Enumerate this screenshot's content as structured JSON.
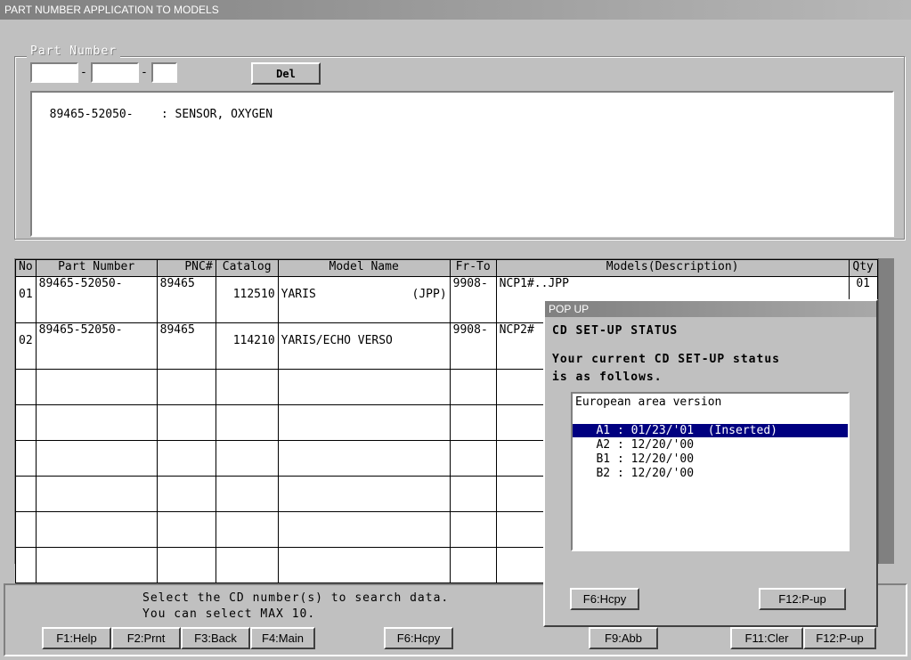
{
  "window": {
    "title": "PART NUMBER APPLICATION TO MODELS"
  },
  "part_number_group": {
    "label": "Part Number",
    "field1": "",
    "field2": "",
    "field3": "",
    "separator": "-",
    "del_label": "Del",
    "result_text": "89465-52050-    : SENSOR, OXYGEN"
  },
  "table": {
    "headers": [
      "No",
      "Part Number",
      "PNC#",
      "Catalog",
      "Model Name",
      "Fr-To",
      "Models(Description)",
      "Qty"
    ],
    "rows": [
      {
        "no": "01",
        "part": "89465-52050-",
        "pnc": "89465",
        "catalog": "112510",
        "model": "YARIS",
        "model_tag": "(JPP)",
        "frto": "9908-",
        "desc": "NCP1#..JPP",
        "qty": "01"
      },
      {
        "no": "02",
        "part": "89465-52050-",
        "pnc": "89465",
        "catalog": "114210",
        "model": "YARIS/ECHO VERSO",
        "model_tag": "",
        "frto": "9908-",
        "desc": "NCP2#",
        "qty": ""
      }
    ]
  },
  "status": {
    "line1": "Select the CD number(s) to search data.",
    "line2": "You can select MAX 10."
  },
  "fkeys": {
    "f1": "F1:Help",
    "f2": "F2:Prnt",
    "f3": "F3:Back",
    "f4": "F4:Main",
    "f6": "F6:Hcpy",
    "f9": "F9:Abb",
    "f11": "F11:Cler",
    "f12": "F12:P-up"
  },
  "popup": {
    "title": "POP UP",
    "heading": "CD SET-UP STATUS",
    "text1": "Your current CD SET-UP status",
    "text2": "is as follows.",
    "list": [
      "European area version",
      "",
      "   A1 : 01/23/'01  (Inserted)",
      "   A2 : 12/20/'00",
      "   B1 : 12/20/'00",
      "   B2 : 12/20/'00"
    ],
    "selected_index": 2,
    "f6_label": "F6:Hcpy",
    "f12_label": "F12:P-up"
  }
}
